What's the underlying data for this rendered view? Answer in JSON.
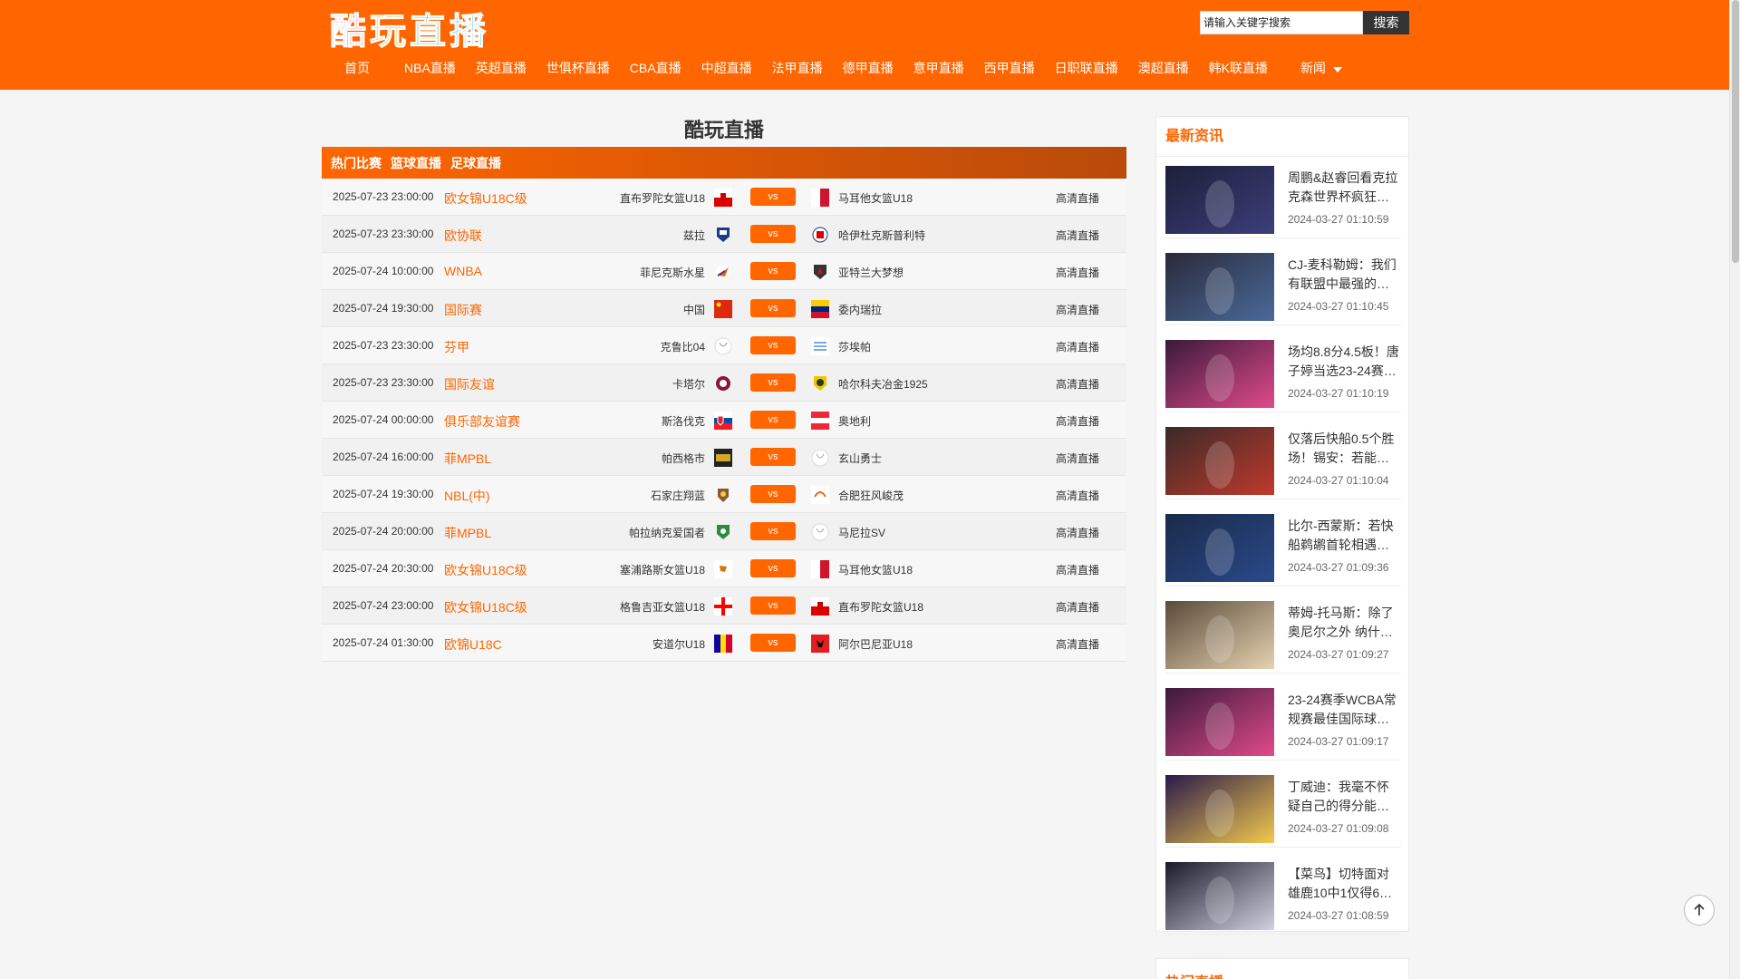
{
  "header": {
    "logo_text": "酷玩直播",
    "search_placeholder": "请输入关键字搜索",
    "search_button": "搜索",
    "nav": [
      "首页",
      "NBA直播",
      "英超直播",
      "世俱杯直播",
      "CBA直播",
      "中超直播",
      "法甲直播",
      "德甲直播",
      "意甲直播",
      "西甲直播",
      "日职联直播",
      "澳超直播",
      "韩K联直播"
    ],
    "nav_more": "新闻"
  },
  "main": {
    "title": "酷玩直播",
    "tabs": [
      "热门比赛",
      "篮球直播",
      "足球直播"
    ],
    "matches": [
      {
        "time": "2025-07-23 23:00:00",
        "league": "欧女锦U18C级",
        "home": "直布罗陀女篮U18",
        "vs": "vs",
        "away": "马耳他女篮U18",
        "hd": "高清直播"
      },
      {
        "time": "2025-07-23 23:30:00",
        "league": "欧协联",
        "home": "兹拉",
        "vs": "vs",
        "away": "哈伊杜克斯普利特",
        "hd": "高清直播"
      },
      {
        "time": "2025-07-24 10:00:00",
        "league": "WNBA",
        "home": "菲尼克斯水星",
        "vs": "vs",
        "away": "亚特兰大梦想",
        "hd": "高清直播"
      },
      {
        "time": "2025-07-24 19:30:00",
        "league": "国际赛",
        "home": "中国",
        "vs": "vs",
        "away": "委内瑞拉",
        "hd": "高清直播"
      },
      {
        "time": "2025-07-23 23:30:00",
        "league": "芬甲",
        "home": "克鲁比04",
        "vs": "vs",
        "away": "莎埃帕",
        "hd": "高清直播"
      },
      {
        "time": "2025-07-23 23:30:00",
        "league": "国际友谊",
        "home": "卡塔尔",
        "vs": "vs",
        "away": "哈尔科夫冶金1925",
        "hd": "高清直播"
      },
      {
        "time": "2025-07-24 00:00:00",
        "league": "俱乐部友谊赛",
        "home": "斯洛伐克",
        "vs": "vs",
        "away": "奥地利",
        "hd": "高清直播"
      },
      {
        "time": "2025-07-24 16:00:00",
        "league": "菲MPBL",
        "home": "帕西格市",
        "vs": "vs",
        "away": "玄山勇士",
        "hd": "高清直播"
      },
      {
        "time": "2025-07-24 19:30:00",
        "league": "NBL(中)",
        "home": "石家庄翔蓝",
        "vs": "vs",
        "away": "合肥狂风峻茂",
        "hd": "高清直播"
      },
      {
        "time": "2025-07-24 20:00:00",
        "league": "菲MPBL",
        "home": "帕拉纳克爱国者",
        "vs": "vs",
        "away": "马尼拉SV",
        "hd": "高清直播"
      },
      {
        "time": "2025-07-24 20:30:00",
        "league": "欧女锦U18C级",
        "home": "塞浦路斯女篮U18",
        "vs": "vs",
        "away": "马耳他女篮U18",
        "hd": "高清直播"
      },
      {
        "time": "2025-07-24 23:00:00",
        "league": "欧女锦U18C级",
        "home": "格鲁吉亚女篮U18",
        "vs": "vs",
        "away": "直布罗陀女篮U18",
        "hd": "高清直播"
      },
      {
        "time": "2025-07-24 01:30:00",
        "league": "欧锦U18C",
        "home": "安道尔U18",
        "vs": "vs",
        "away": "阿尔巴尼亚U18",
        "hd": "高清直播"
      }
    ]
  },
  "sidebar": {
    "title": "最新资讯",
    "news": [
      {
        "title": "周鹏&赵睿回看克拉克森世界杯疯狂…",
        "time": "2024-03-27 01:10:59"
      },
      {
        "title": "CJ-麦科勒姆：我们有联盟中最强的…",
        "time": "2024-03-27 01:10:45"
      },
      {
        "title": "场均8.8分4.5板！唐子婷当选23-24赛…",
        "time": "2024-03-27 01:10:19"
      },
      {
        "title": "仅落后快船0.5个胜场！锡安：若能…",
        "time": "2024-03-27 01:10:04"
      },
      {
        "title": "比尔-西蒙斯：若快船鹈鹕首轮相遇…",
        "time": "2024-03-27 01:09:36"
      },
      {
        "title": "蒂姆-托马斯：除了奥尼尔之外 纳什…",
        "time": "2024-03-27 01:09:27"
      },
      {
        "title": "23-24赛季WCBA常规赛最佳国际球…",
        "time": "2024-03-27 01:09:17"
      },
      {
        "title": "丁威迪：我毫不怀疑自己的得分能…",
        "time": "2024-03-27 01:09:08"
      },
      {
        "title": "【菜鸟】切特面对雄鹿10中1仅得6…",
        "time": "2024-03-27 01:08:59"
      }
    ],
    "title2": "热门直播"
  },
  "colors": {
    "accent": "#ff6600",
    "header_bg": "#ff6600"
  }
}
